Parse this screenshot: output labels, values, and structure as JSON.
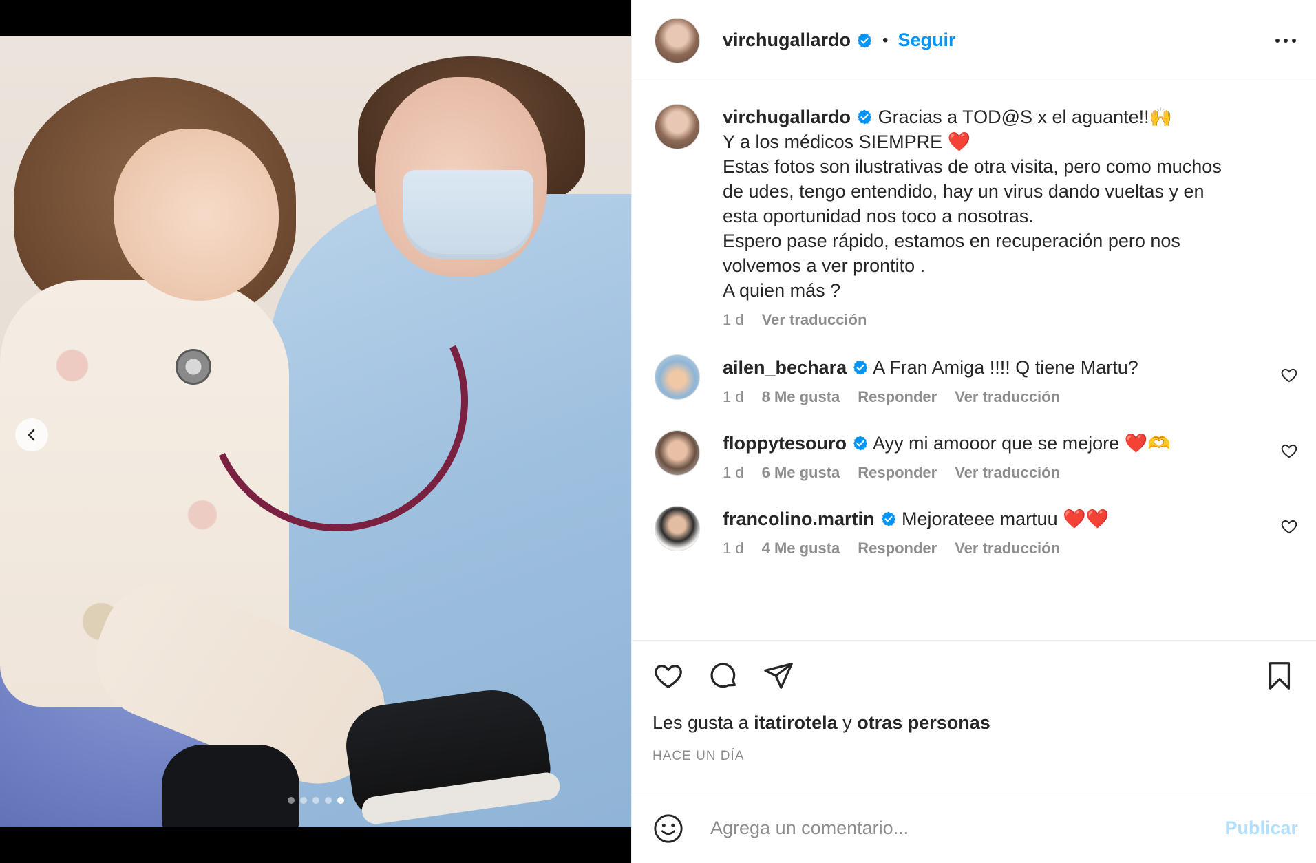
{
  "colors": {
    "accent": "#0095f6",
    "text": "#262626",
    "muted": "#8e8e8e",
    "publish_disabled": "#b2dffc",
    "heart_emoji": "#e0245e"
  },
  "media": {
    "carousel_total": 5,
    "carousel_active": 5
  },
  "header": {
    "username": "virchugallardo",
    "separator": "•",
    "follow_label": "Seguir"
  },
  "caption": {
    "username": "virchugallardo",
    "lines": [
      "Gracias a TOD@S x el aguante!!🙌",
      "Y a los médicos SIEMPRE ❤️",
      "Estas fotos son ilustrativas de otra visita, pero como muchos",
      "de udes, tengo entendido, hay un virus dando vueltas y en",
      "esta oportunidad nos toco a nosotras.",
      "Espero pase rápido, estamos en recuperación pero nos",
      "volvemos a ver prontito .",
      "A quien más ?"
    ],
    "time": "1 d",
    "translate": "Ver traducción"
  },
  "comments": [
    {
      "username": "ailen_bechara",
      "text": "A Fran Amiga !!!! Q tiene Martu?",
      "time": "1 d",
      "likes": "8 Me gusta",
      "reply": "Responder",
      "translate": "Ver traducción"
    },
    {
      "username": "floppytesouro",
      "text": "Ayy mi amooor que se mejore ❤️🫶",
      "time": "1 d",
      "likes": "6 Me gusta",
      "reply": "Responder",
      "translate": "Ver traducción"
    },
    {
      "username": "francolino.martin",
      "text": "Mejorateee martuu ❤️❤️",
      "time": "1 d",
      "likes": "4 Me gusta",
      "reply": "Responder",
      "translate": "Ver traducción"
    }
  ],
  "likes": {
    "prefix": "Les gusta a",
    "user": "itatirotela",
    "conj": "y",
    "others": "otras personas"
  },
  "posted": "HACE UN DÍA",
  "composer": {
    "placeholder": "Agrega un comentario...",
    "publish_label": "Publicar"
  },
  "icons": [
    "chevron-left-icon",
    "more-icon",
    "verified-icon",
    "heart-icon",
    "comment-icon",
    "share-icon",
    "bookmark-icon",
    "emoji-icon"
  ]
}
